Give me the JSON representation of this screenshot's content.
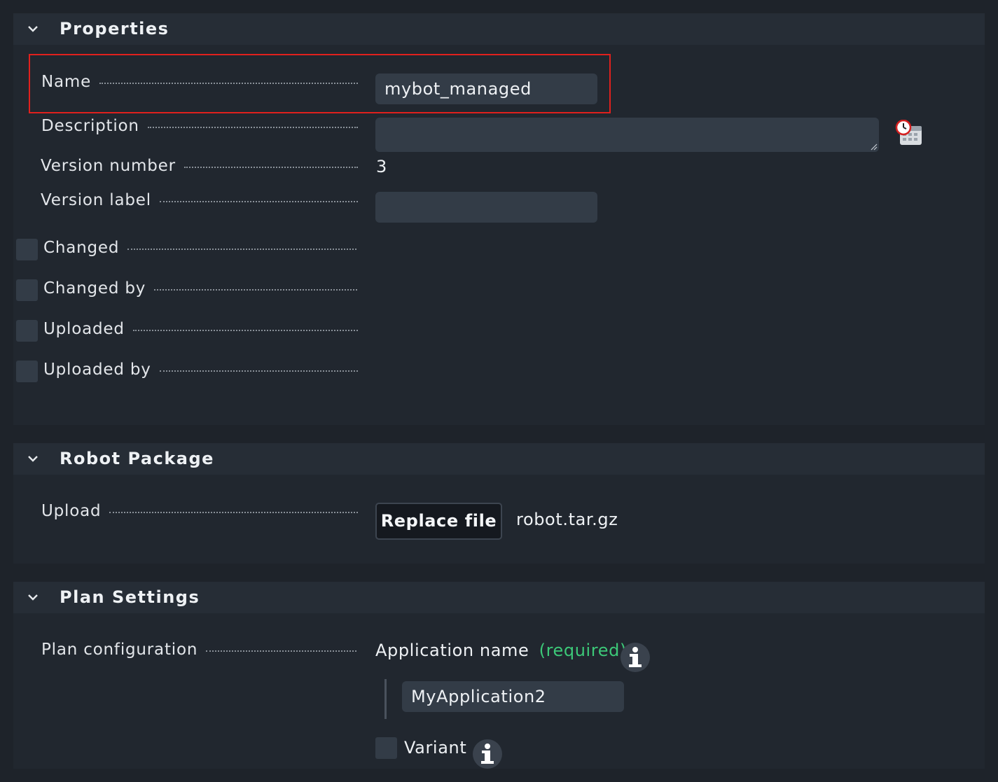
{
  "properties": {
    "title": "Properties",
    "name_label": "Name",
    "name_value": "mybot_managed",
    "description_label": "Description",
    "description_value": "",
    "version_number_label": "Version number",
    "version_number_value": "3",
    "version_label_label": "Version label",
    "version_label_value": "",
    "changed_label": "Changed",
    "changed_by_label": "Changed by",
    "uploaded_label": "Uploaded",
    "uploaded_by_label": "Uploaded by"
  },
  "robot_package": {
    "title": "Robot Package",
    "upload_label": "Upload",
    "replace_button": "Replace file",
    "file_name": "robot.tar.gz"
  },
  "plan_settings": {
    "title": "Plan Settings",
    "plan_config_label": "Plan configuration",
    "app_name_label": "Application name",
    "required_text": "(required)",
    "app_name_value": "MyApplication2",
    "variant_label": "Variant"
  },
  "colors": {
    "background": "#1e232a",
    "panel": "#21272f",
    "header": "#262d36",
    "input": "#333c47",
    "highlight_border": "#e0201d",
    "required_green": "#3cc878"
  },
  "icons": [
    "chevron-down-icon",
    "calendar-clock-icon",
    "info-icon"
  ]
}
